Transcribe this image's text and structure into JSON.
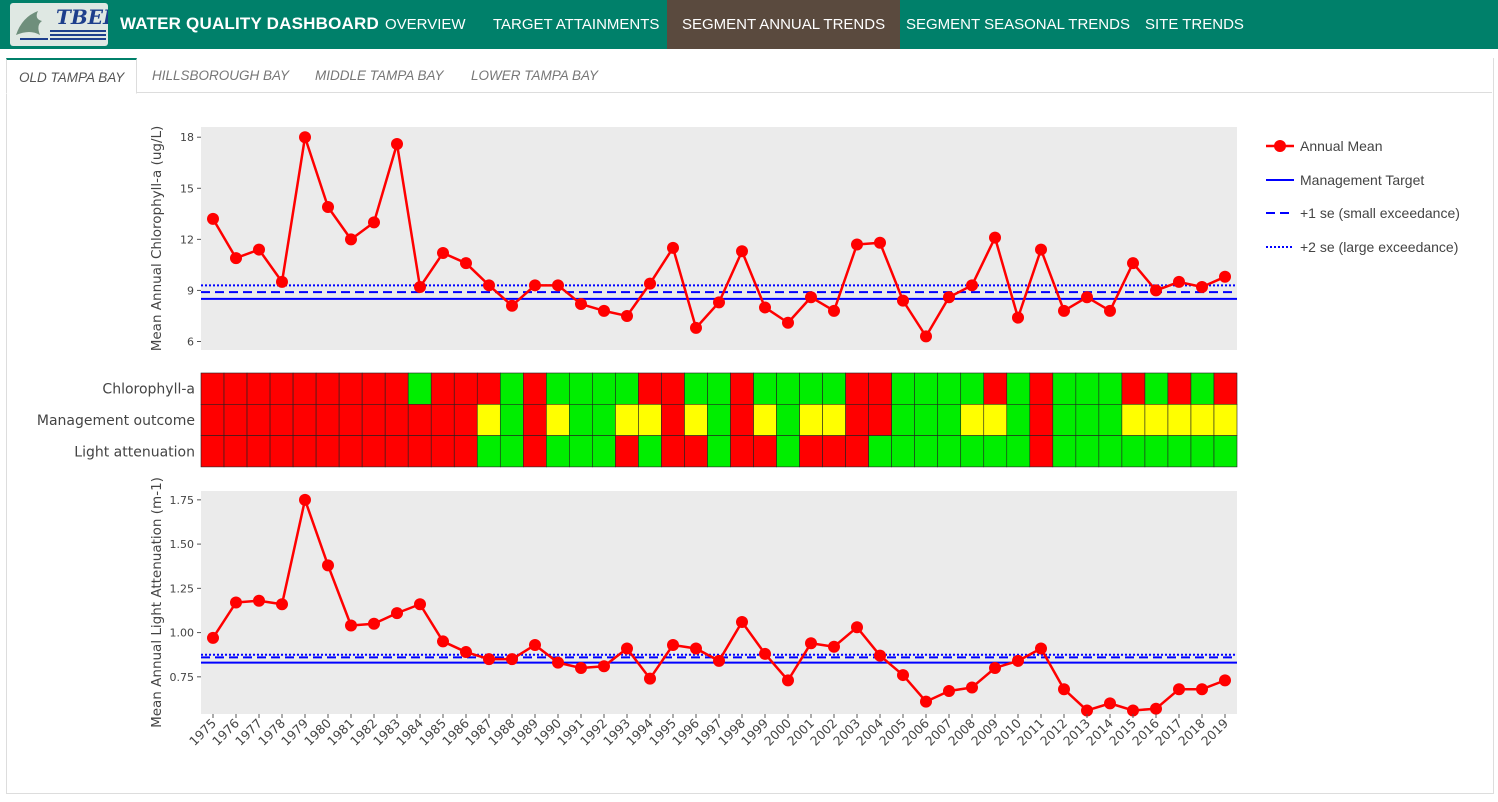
{
  "brand": "WATER QUALITY DASHBOARD",
  "logo_text": "TBEP",
  "nav": [
    "OVERVIEW",
    "TARGET ATTAINMENTS",
    "SEGMENT ANNUAL TRENDS",
    "SEGMENT SEASONAL TRENDS",
    "SITE TRENDS"
  ],
  "nav_active": 2,
  "tabs": [
    "OLD TAMPA BAY",
    "HILLSBOROUGH BAY",
    "MIDDLE TAMPA BAY",
    "LOWER TAMPA BAY"
  ],
  "tab_active": 0,
  "colors": {
    "navbar": "#00806a",
    "nav_active": "#5a4a3e",
    "series": "#ff0000",
    "target": "#0000ff",
    "red": "#ff0000",
    "yellow": "#ffff00",
    "green": "#00ee00",
    "panel": "#ebebeb"
  },
  "chart_data": [
    {
      "type": "line",
      "ylabel": "Mean Annual Chlorophyll-a (ug/L)",
      "ylim": [
        5.5,
        18.6
      ],
      "yticks": [
        6,
        9,
        12,
        15,
        18
      ],
      "grid": false,
      "x": [
        1975,
        1976,
        1977,
        1978,
        1979,
        1980,
        1981,
        1982,
        1983,
        1984,
        1985,
        1986,
        1987,
        1988,
        1989,
        1990,
        1991,
        1992,
        1993,
        1994,
        1995,
        1996,
        1997,
        1998,
        1999,
        2000,
        2001,
        2002,
        2003,
        2004,
        2005,
        2006,
        2007,
        2008,
        2009,
        2010,
        2011,
        2012,
        2013,
        2014,
        2015,
        2016,
        2017,
        2018,
        2019
      ],
      "series": [
        {
          "name": "Annual Mean",
          "style": "line+markers",
          "values": [
            13.2,
            10.9,
            11.4,
            9.5,
            18.0,
            13.9,
            12.0,
            13.0,
            17.6,
            9.2,
            11.2,
            10.6,
            9.3,
            8.1,
            9.3,
            9.3,
            8.2,
            7.8,
            7.5,
            9.4,
            11.5,
            6.8,
            8.3,
            11.3,
            8.0,
            7.1,
            8.6,
            7.8,
            11.7,
            11.8,
            8.4,
            6.3,
            8.6,
            9.3,
            12.1,
            7.4,
            11.4,
            7.8,
            8.6,
            7.8,
            10.6,
            9.0,
            9.5,
            9.2,
            9.8
          ]
        }
      ],
      "reference_lines": [
        {
          "name": "Management Target",
          "value": 8.5,
          "style": "solid"
        },
        {
          "name": "+1 se (small exceedance)",
          "value": 8.9,
          "style": "dash"
        },
        {
          "name": "+2 se (large exceedance)",
          "value": 9.3,
          "style": "dot"
        }
      ]
    },
    {
      "type": "heatmap",
      "rows": [
        "Chlorophyll-a",
        "Management outcome",
        "Light attenuation"
      ],
      "x": [
        1975,
        1976,
        1977,
        1978,
        1979,
        1980,
        1981,
        1982,
        1983,
        1984,
        1985,
        1986,
        1987,
        1988,
        1989,
        1990,
        1991,
        1992,
        1993,
        1994,
        1995,
        1996,
        1997,
        1998,
        1999,
        2000,
        2001,
        2002,
        2003,
        2004,
        2005,
        2006,
        2007,
        2008,
        2009,
        2010,
        2011,
        2012,
        2013,
        2014,
        2015,
        2016,
        2017,
        2018,
        2019
      ],
      "values": [
        [
          "red",
          "red",
          "red",
          "red",
          "red",
          "red",
          "red",
          "red",
          "red",
          "green",
          "red",
          "red",
          "red",
          "green",
          "red",
          "green",
          "green",
          "green",
          "green",
          "red",
          "red",
          "green",
          "green",
          "red",
          "green",
          "green",
          "green",
          "green",
          "red",
          "red",
          "green",
          "green",
          "green",
          "green",
          "red",
          "green",
          "red",
          "green",
          "green",
          "green",
          "red",
          "green",
          "red",
          "green",
          "red"
        ],
        [
          "red",
          "red",
          "red",
          "red",
          "red",
          "red",
          "red",
          "red",
          "red",
          "red",
          "red",
          "red",
          "yellow",
          "green",
          "red",
          "yellow",
          "green",
          "green",
          "yellow",
          "yellow",
          "red",
          "yellow",
          "green",
          "red",
          "yellow",
          "green",
          "yellow",
          "yellow",
          "red",
          "red",
          "green",
          "green",
          "green",
          "yellow",
          "yellow",
          "green",
          "red",
          "green",
          "green",
          "green",
          "yellow",
          "yellow",
          "yellow",
          "yellow",
          "yellow"
        ],
        [
          "red",
          "red",
          "red",
          "red",
          "red",
          "red",
          "red",
          "red",
          "red",
          "red",
          "red",
          "red",
          "green",
          "green",
          "red",
          "green",
          "green",
          "green",
          "red",
          "green",
          "red",
          "red",
          "green",
          "red",
          "red",
          "green",
          "red",
          "red",
          "red",
          "green",
          "green",
          "green",
          "green",
          "green",
          "green",
          "green",
          "red",
          "green",
          "green",
          "green",
          "green",
          "green",
          "green",
          "green",
          "green"
        ]
      ]
    },
    {
      "type": "line",
      "ylabel": "Mean Annual Light Attenuation (m-1)",
      "ylim": [
        0.54,
        1.8
      ],
      "yticks": [
        0.75,
        1.0,
        1.25,
        1.5,
        1.75
      ],
      "ytick_labels": [
        "0.75",
        "1.00",
        "1.25",
        "1.50",
        "1.75"
      ],
      "grid": false,
      "x": [
        1975,
        1976,
        1977,
        1978,
        1979,
        1980,
        1981,
        1982,
        1983,
        1984,
        1985,
        1986,
        1987,
        1988,
        1989,
        1990,
        1991,
        1992,
        1993,
        1994,
        1995,
        1996,
        1997,
        1998,
        1999,
        2000,
        2001,
        2002,
        2003,
        2004,
        2005,
        2006,
        2007,
        2008,
        2009,
        2010,
        2011,
        2012,
        2013,
        2014,
        2015,
        2016,
        2017,
        2018,
        2019
      ],
      "series": [
        {
          "name": "Annual Mean",
          "style": "line+markers",
          "values": [
            0.97,
            1.17,
            1.18,
            1.16,
            1.75,
            1.38,
            1.04,
            1.05,
            1.11,
            1.16,
            0.95,
            0.89,
            0.85,
            0.85,
            0.93,
            0.83,
            0.8,
            0.81,
            0.91,
            0.74,
            0.93,
            0.91,
            0.84,
            1.06,
            0.88,
            0.73,
            0.94,
            0.92,
            1.03,
            0.87,
            0.76,
            0.61,
            0.67,
            0.69,
            0.8,
            0.84,
            0.91,
            0.68,
            0.56,
            0.6,
            0.56,
            0.57,
            0.68,
            0.68,
            0.73
          ]
        }
      ],
      "reference_lines": [
        {
          "name": "Management Target",
          "value": 0.83,
          "style": "solid"
        },
        {
          "name": "+1 se (small exceedance)",
          "value": 0.86,
          "style": "dash"
        },
        {
          "name": "+2 se (large exceedance)",
          "value": 0.875,
          "style": "dot"
        }
      ]
    }
  ],
  "legend": {
    "position": "right",
    "items": [
      {
        "label": "Annual Mean",
        "style": "line+marker"
      },
      {
        "label": "Management Target",
        "style": "solid"
      },
      {
        "label": "+1 se (small exceedance)",
        "style": "dash"
      },
      {
        "label": "+2 se (large exceedance)",
        "style": "dot"
      }
    ]
  }
}
